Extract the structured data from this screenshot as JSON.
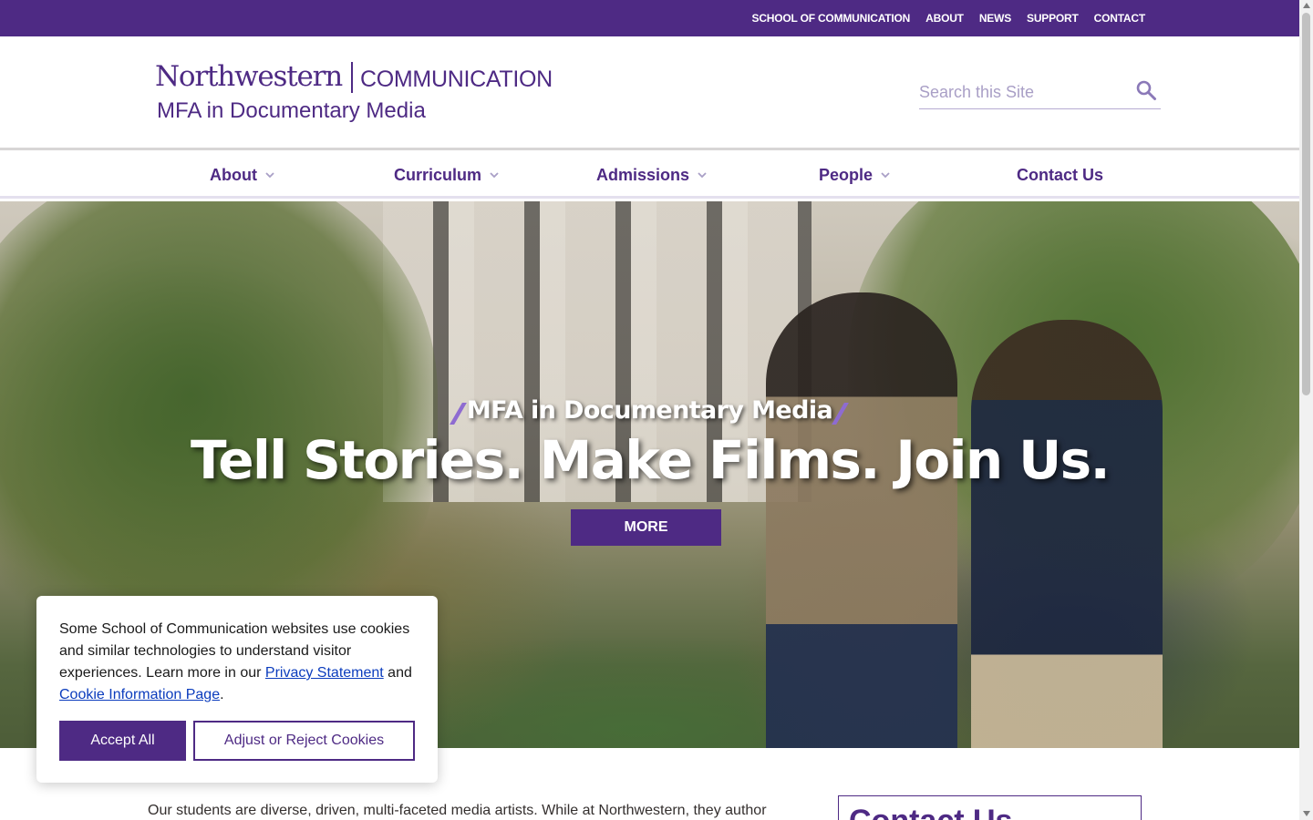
{
  "utility_nav": [
    "SCHOOL OF COMMUNICATION",
    "ABOUT",
    "NEWS",
    "SUPPORT",
    "CONTACT"
  ],
  "logo": {
    "university": "Northwestern",
    "school": "COMMUNICATION",
    "program": "MFA in Documentary Media"
  },
  "search": {
    "placeholder": "Search this Site",
    "icon": "search-icon"
  },
  "main_nav": [
    {
      "label": "About",
      "has_dropdown": true
    },
    {
      "label": "Curriculum",
      "has_dropdown": true
    },
    {
      "label": "Admissions",
      "has_dropdown": true
    },
    {
      "label": "People",
      "has_dropdown": true
    },
    {
      "label": "Contact Us",
      "has_dropdown": false
    }
  ],
  "hero": {
    "kicker": "MFA in Documentary Media",
    "title": "Tell Stories. Make Films. Join Us.",
    "button": "MORE"
  },
  "intro": {
    "text": "Our students are diverse, driven, multi-faceted media artists. While at Northwestern, they author"
  },
  "sidebar": {
    "contact_title": "Contact Us"
  },
  "cookie": {
    "text_before": "Some School of Communication websites use cookies and similar technologies to understand visitor experiences. Learn more in our ",
    "privacy_link": "Privacy Statement",
    "text_and": " and ",
    "cookie_link": "Cookie Information Page",
    "text_end": ".",
    "accept": "Accept All",
    "adjust": "Adjust or Reject Cookies"
  },
  "colors": {
    "brand_purple": "#4e2a84",
    "link_blue": "#0b3cbd",
    "accent_slash": "#8e6bd1"
  }
}
